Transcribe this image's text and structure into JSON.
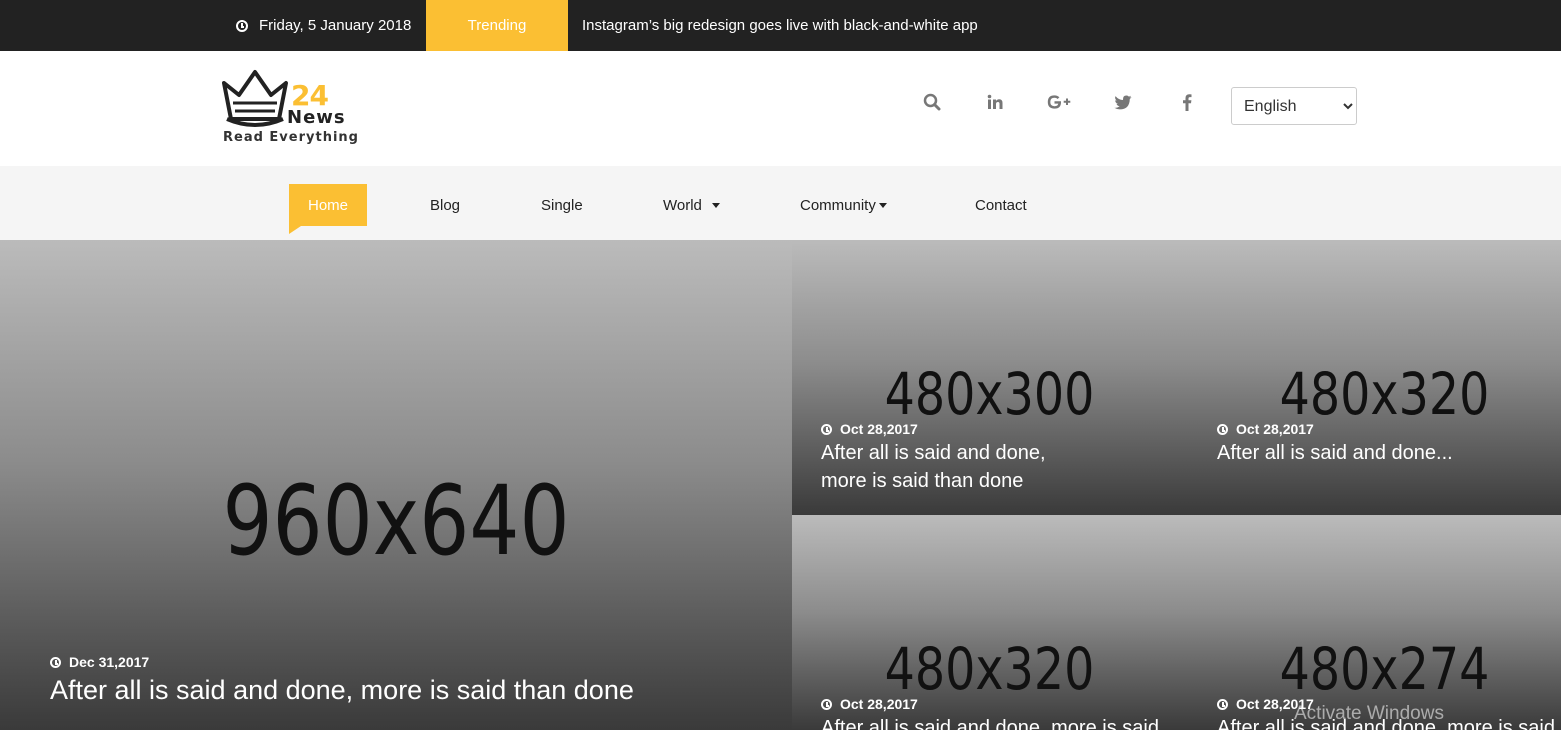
{
  "topbar": {
    "date": "Friday, 5 January 2018",
    "trending_label": "Trending",
    "headline": "Instagram’s big redesign goes live with black-and-white app"
  },
  "header": {
    "logo": {
      "number": "24",
      "word": "News",
      "tagline": "Read Everything"
    },
    "icons": [
      "search-icon",
      "linkedin-icon",
      "google-plus-icon",
      "twitter-icon",
      "facebook-icon"
    ],
    "language": {
      "selected": "English"
    }
  },
  "nav": {
    "items": [
      {
        "label": "Home"
      },
      {
        "label": "Blog"
      },
      {
        "label": "Single"
      },
      {
        "label": "World"
      },
      {
        "label": "Community"
      },
      {
        "label": "Contact"
      }
    ]
  },
  "posts": {
    "main": {
      "placeholder": "960x640",
      "date": "Dec 31,2017",
      "title": "After all is said and done, more is said than done"
    },
    "top_left": {
      "placeholder": "480x300",
      "date": "Oct 28,2017",
      "title": "After all is said and done, more is said than done"
    },
    "top_right": {
      "placeholder": "480x320",
      "date": "Oct 28,2017",
      "title": "After all is said and done..."
    },
    "bottom_left": {
      "placeholder": "480x320",
      "date": "Oct 28,2017",
      "title": "After all is said and done, more is said"
    },
    "bottom_right": {
      "placeholder": "480x274",
      "date": "Oct 28,2017",
      "title": "After all is said and done, more is said"
    }
  },
  "watermark": "Activate Windows",
  "colors": {
    "accent": "#fbbf33",
    "topbar": "#222222",
    "nav_bg": "#f5f5f5"
  }
}
